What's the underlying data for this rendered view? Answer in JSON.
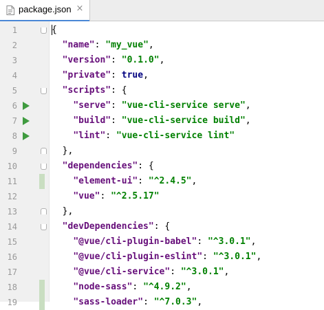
{
  "tab": {
    "filename": "package.json",
    "close_glyph": "×"
  },
  "lines": [
    {
      "n": "1",
      "change": false,
      "run": false,
      "fold": "open",
      "indent": "",
      "tokens": [
        {
          "t": "p",
          "v": "{"
        }
      ]
    },
    {
      "n": "2",
      "change": false,
      "run": false,
      "fold": "",
      "indent": "  ",
      "tokens": [
        {
          "t": "k",
          "v": "\"name\""
        },
        {
          "t": "p",
          "v": ": "
        },
        {
          "t": "s",
          "v": "\"my_vue\""
        },
        {
          "t": "p",
          "v": ","
        }
      ]
    },
    {
      "n": "3",
      "change": false,
      "run": false,
      "fold": "",
      "indent": "  ",
      "tokens": [
        {
          "t": "k",
          "v": "\"version\""
        },
        {
          "t": "p",
          "v": ": "
        },
        {
          "t": "s",
          "v": "\"0.1.0\""
        },
        {
          "t": "p",
          "v": ","
        }
      ]
    },
    {
      "n": "4",
      "change": false,
      "run": false,
      "fold": "",
      "indent": "  ",
      "tokens": [
        {
          "t": "k",
          "v": "\"private\""
        },
        {
          "t": "p",
          "v": ": "
        },
        {
          "t": "kw",
          "v": "true"
        },
        {
          "t": "p",
          "v": ","
        }
      ]
    },
    {
      "n": "5",
      "change": false,
      "run": false,
      "fold": "open",
      "indent": "  ",
      "tokens": [
        {
          "t": "k",
          "v": "\"scripts\""
        },
        {
          "t": "p",
          "v": ": {"
        }
      ]
    },
    {
      "n": "6",
      "change": false,
      "run": true,
      "fold": "",
      "indent": "    ",
      "tokens": [
        {
          "t": "k",
          "v": "\"serve\""
        },
        {
          "t": "p",
          "v": ": "
        },
        {
          "t": "s",
          "v": "\"vue-cli-service serve\""
        },
        {
          "t": "p",
          "v": ","
        }
      ]
    },
    {
      "n": "7",
      "change": false,
      "run": true,
      "fold": "",
      "indent": "    ",
      "tokens": [
        {
          "t": "k",
          "v": "\"build\""
        },
        {
          "t": "p",
          "v": ": "
        },
        {
          "t": "s",
          "v": "\"vue-cli-service build\""
        },
        {
          "t": "p",
          "v": ","
        }
      ]
    },
    {
      "n": "8",
      "change": false,
      "run": true,
      "fold": "",
      "indent": "    ",
      "tokens": [
        {
          "t": "k",
          "v": "\"lint\""
        },
        {
          "t": "p",
          "v": ": "
        },
        {
          "t": "s",
          "v": "\"vue-cli-service lint\""
        }
      ]
    },
    {
      "n": "9",
      "change": false,
      "run": false,
      "fold": "close",
      "indent": "  ",
      "tokens": [
        {
          "t": "p",
          "v": "},"
        }
      ]
    },
    {
      "n": "10",
      "change": false,
      "run": false,
      "fold": "open",
      "indent": "  ",
      "tokens": [
        {
          "t": "k",
          "v": "\"dependencies\""
        },
        {
          "t": "p",
          "v": ": {"
        }
      ]
    },
    {
      "n": "11",
      "change": true,
      "run": false,
      "fold": "",
      "indent": "    ",
      "tokens": [
        {
          "t": "k",
          "v": "\"element-ui\""
        },
        {
          "t": "p",
          "v": ": "
        },
        {
          "t": "s",
          "v": "\"^2.4.5\""
        },
        {
          "t": "p",
          "v": ","
        }
      ]
    },
    {
      "n": "12",
      "change": false,
      "run": false,
      "fold": "",
      "indent": "    ",
      "tokens": [
        {
          "t": "k",
          "v": "\"vue\""
        },
        {
          "t": "p",
          "v": ": "
        },
        {
          "t": "s",
          "v": "\"^2.5.17\""
        }
      ]
    },
    {
      "n": "13",
      "change": false,
      "run": false,
      "fold": "close",
      "indent": "  ",
      "tokens": [
        {
          "t": "p",
          "v": "},"
        }
      ]
    },
    {
      "n": "14",
      "change": false,
      "run": false,
      "fold": "open",
      "indent": "  ",
      "tokens": [
        {
          "t": "k",
          "v": "\"devDependencies\""
        },
        {
          "t": "p",
          "v": ": {"
        }
      ]
    },
    {
      "n": "15",
      "change": false,
      "run": false,
      "fold": "",
      "indent": "    ",
      "tokens": [
        {
          "t": "k",
          "v": "\"@vue/cli-plugin-babel\""
        },
        {
          "t": "p",
          "v": ": "
        },
        {
          "t": "s",
          "v": "\"^3.0.1\""
        },
        {
          "t": "p",
          "v": ","
        }
      ]
    },
    {
      "n": "16",
      "change": false,
      "run": false,
      "fold": "",
      "indent": "    ",
      "tokens": [
        {
          "t": "k",
          "v": "\"@vue/cli-plugin-eslint\""
        },
        {
          "t": "p",
          "v": ": "
        },
        {
          "t": "s",
          "v": "\"^3.0.1\""
        },
        {
          "t": "p",
          "v": ","
        }
      ]
    },
    {
      "n": "17",
      "change": false,
      "run": false,
      "fold": "",
      "indent": "    ",
      "tokens": [
        {
          "t": "k",
          "v": "\"@vue/cli-service\""
        },
        {
          "t": "p",
          "v": ": "
        },
        {
          "t": "s",
          "v": "\"^3.0.1\""
        },
        {
          "t": "p",
          "v": ","
        }
      ]
    },
    {
      "n": "18",
      "change": true,
      "run": false,
      "fold": "",
      "indent": "    ",
      "tokens": [
        {
          "t": "k",
          "v": "\"node-sass\""
        },
        {
          "t": "p",
          "v": ": "
        },
        {
          "t": "s",
          "v": "\"^4.9.2\""
        },
        {
          "t": "p",
          "v": ","
        }
      ]
    },
    {
      "n": "19",
      "change": true,
      "run": false,
      "fold": "",
      "indent": "    ",
      "tokens": [
        {
          "t": "k",
          "v": "\"sass-loader\""
        },
        {
          "t": "p",
          "v": ": "
        },
        {
          "t": "s",
          "v": "\"^7.0.3\""
        },
        {
          "t": "p",
          "v": ","
        }
      ]
    }
  ]
}
